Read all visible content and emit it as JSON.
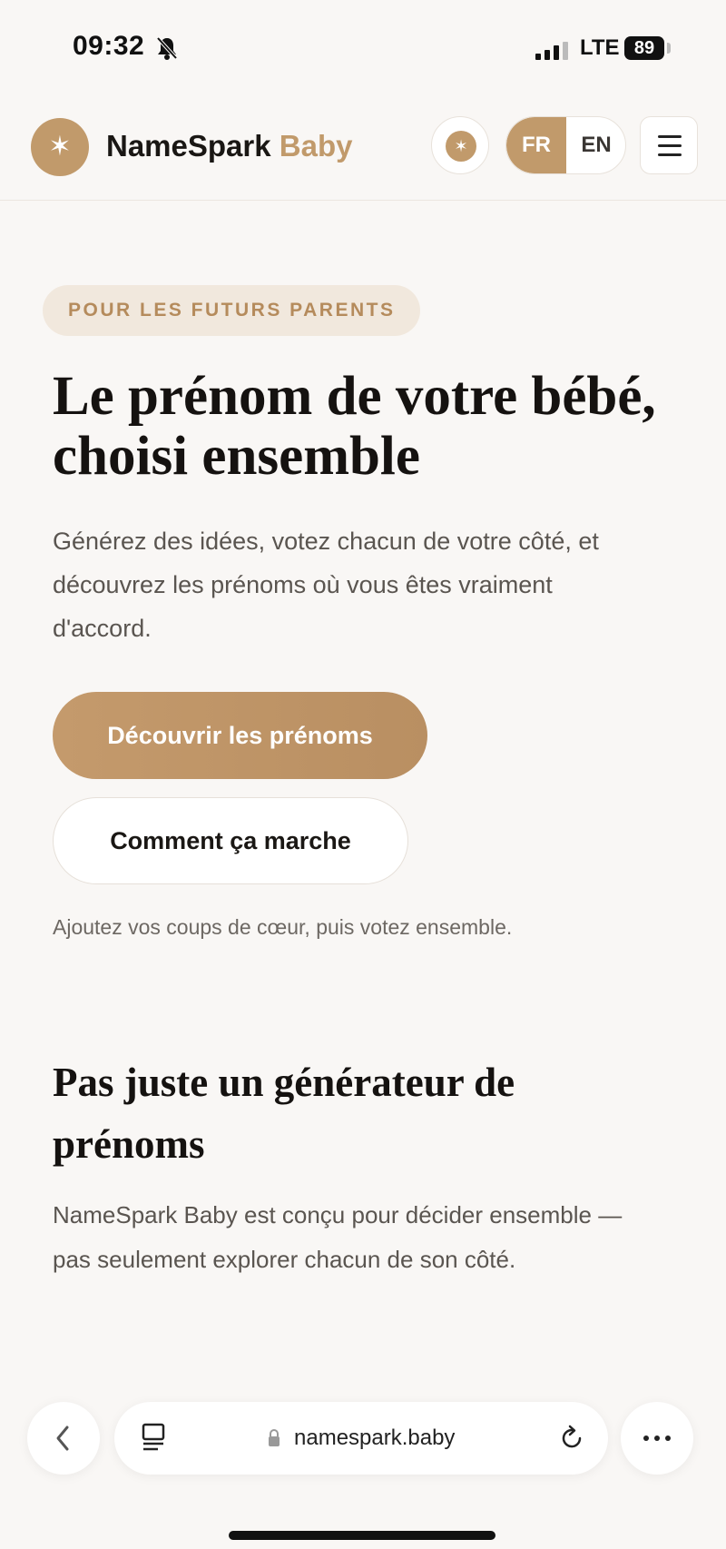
{
  "status": {
    "time": "09:32",
    "network": "LTE",
    "battery": "89"
  },
  "header": {
    "brand_main": "NameSpark",
    "brand_accent": "Baby",
    "lang_fr": "FR",
    "lang_en": "EN"
  },
  "hero": {
    "eyebrow": "POUR LES FUTURS PARENTS",
    "title": "Le prénom de votre bébé, choisi ensemble",
    "text": "Générez des idées, votez chacun de votre côté, et découvrez les prénoms où vous êtes vraiment d'accord.",
    "primary_button": "Découvrir les prénoms",
    "secondary_button": "Comment ça marche",
    "hint": "Ajoutez vos coups de cœur, puis votez ensemble."
  },
  "section": {
    "title": "Pas juste un générateur de prénoms",
    "text": "NameSpark Baby est conçu pour décider ensemble — pas seulement explorer chacun de son côté."
  },
  "browser": {
    "url": "namespark.baby"
  },
  "colors": {
    "accent": "#c19a6b",
    "background": "#f9f7f5"
  }
}
